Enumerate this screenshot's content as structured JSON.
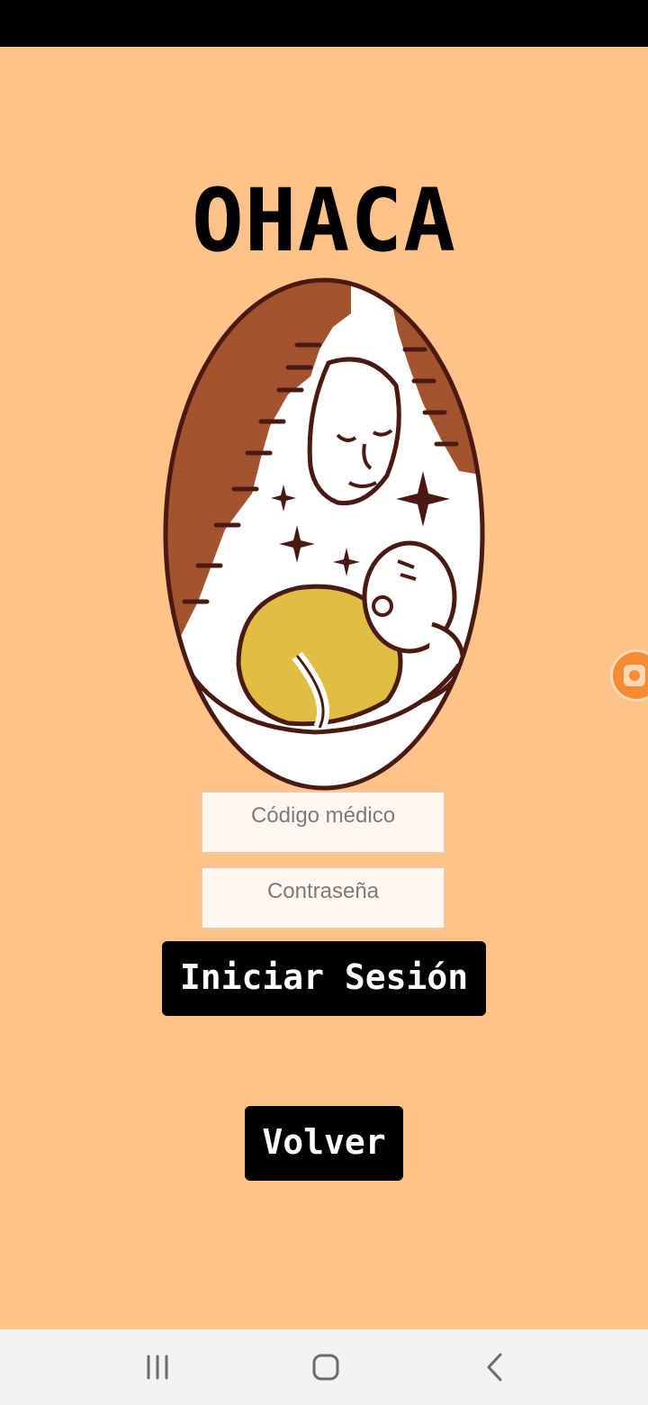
{
  "app": {
    "title": "OHACA"
  },
  "login": {
    "code_placeholder": "Código médico",
    "password_placeholder": "Contraseña",
    "submit_label": "Iniciar Sesión",
    "back_label": "Volver"
  },
  "logo": {
    "icon": "mother-and-baby-logo"
  },
  "floating": {
    "icon": "screen-recorder-icon"
  },
  "navigation": {
    "recents_icon": "recents-icon",
    "home_icon": "home-icon",
    "back_icon": "back-chevron-icon"
  },
  "colors": {
    "background": "#ffc389",
    "button": "#000000",
    "button_text": "#ffffff",
    "logo_brown": "#a4532f",
    "logo_yellow": "#dfbe42",
    "logo_outline": "#4a1a12"
  }
}
